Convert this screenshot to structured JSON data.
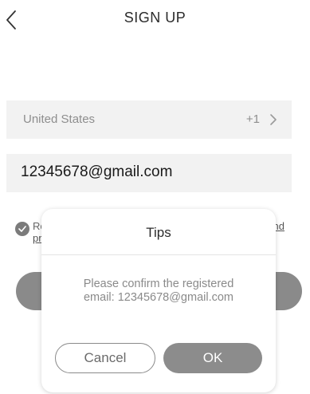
{
  "header": {
    "title": "SIGN UP"
  },
  "form": {
    "country_name": "United States",
    "country_code": "+1",
    "email_value": "12345678@gmail.com"
  },
  "agreement": {
    "text_start": "Re",
    "text_end": "ent and",
    "line2_start": "pr"
  },
  "dialog": {
    "title": "Tips",
    "message_line1": "Please confirm the registered",
    "message_line2": "email: 12345678@gmail.com",
    "cancel_label": "Cancel",
    "ok_label": "OK"
  },
  "colors": {
    "accent_gray": "#8c8c8c",
    "field_bg": "#f2f2f2"
  },
  "icons": {
    "back": "chevron-left-icon",
    "country_arrow": "chevron-right-icon",
    "agree": "check-circle-icon"
  }
}
